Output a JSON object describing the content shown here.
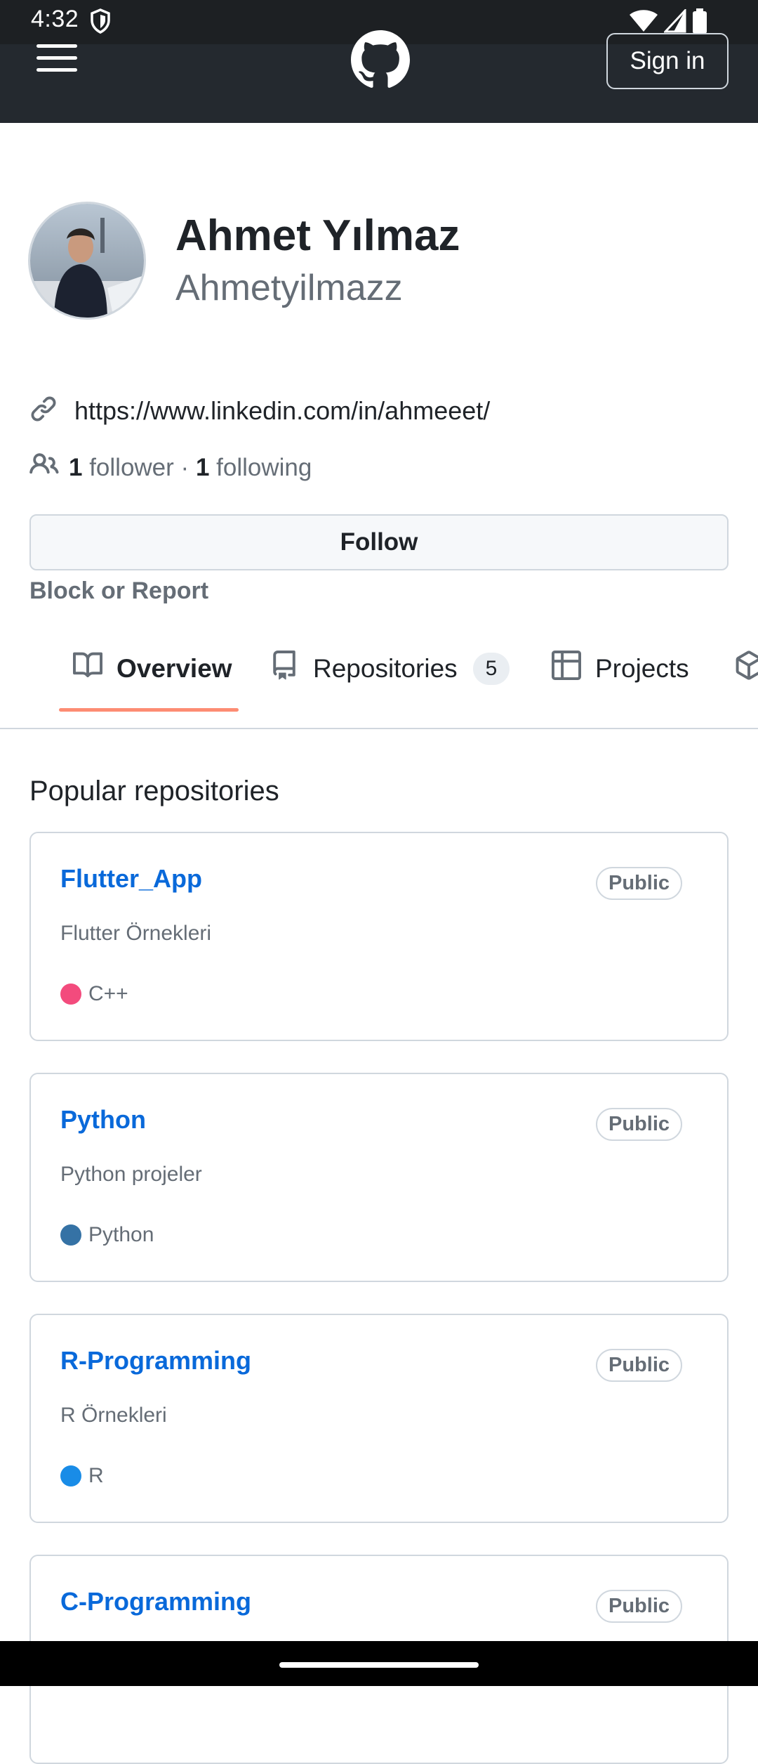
{
  "status_bar": {
    "time": "4:32"
  },
  "header": {
    "sign_in_label": "Sign in"
  },
  "profile": {
    "name": "Ahmet Yılmaz",
    "username": "Ahmetyilmazz",
    "website": "https://www.linkedin.com/in/ahmeeet/",
    "followers_count": "1",
    "followers_label": "follower",
    "separator": "·",
    "following_count": "1",
    "following_label": "following",
    "follow_label": "Follow",
    "block_report_label": "Block or Report"
  },
  "tabs": [
    {
      "label": "Overview",
      "icon": "book-icon",
      "active": true
    },
    {
      "label": "Repositories",
      "icon": "repo-icon",
      "count": "5"
    },
    {
      "label": "Projects",
      "icon": "table-icon"
    },
    {
      "label": "",
      "icon": "package-icon"
    }
  ],
  "popular": {
    "title": "Popular repositories",
    "repos": [
      {
        "name": "Flutter_App",
        "visibility": "Public",
        "description": "Flutter Örnekleri",
        "language": "C++",
        "color": "#f34b7d"
      },
      {
        "name": "Python",
        "visibility": "Public",
        "description": "Python projeler",
        "language": "Python",
        "color": "#3572A5"
      },
      {
        "name": "R-Programming",
        "visibility": "Public",
        "description": "R Örnekleri",
        "language": "R",
        "color": "#198CE7"
      },
      {
        "name": "C-Programming",
        "visibility": "Public"
      }
    ]
  }
}
